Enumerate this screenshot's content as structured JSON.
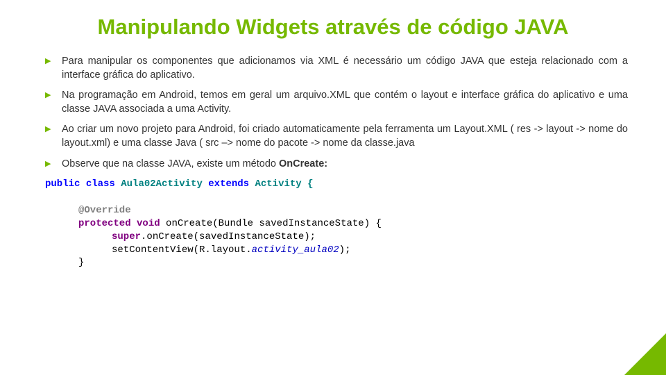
{
  "title": "Manipulando Widgets através de código JAVA",
  "bullets": [
    "Para manipular os componentes que adicionamos via XML é necessário um código JAVA que esteja relacionado com a interface gráfica do aplicativo.",
    "Na programação em Android, temos em geral um arquivo.XML que contém o layout e interface gráfica do aplicativo e uma classe JAVA associada a uma Activity.",
    "Ao criar um novo projeto para Android, foi criado automaticamente pela ferramenta um Layout.XML ( res -> layout -> nome do layout.xml) e uma classe Java ( src –> nome do pacote -> nome da classe.java",
    "Observe que na classe JAVA, existe um método "
  ],
  "bullet4_bold": "OnCreate:",
  "code": {
    "l1_a": "public",
    "l1_b": "class",
    "l1_c": " Aula02Activity ",
    "l1_d": "extends",
    "l1_e": " Activity {",
    "l2": "@Override",
    "l3_a": "protected",
    "l3_b": "void",
    "l3_c": " onCreate(Bundle savedInstanceState) {",
    "l4_a": "super",
    "l4_b": ".onCreate(savedInstanceState);",
    "l5_a": "setContentView(R.layout.",
    "l5_b": "activity_aula02",
    "l5_c": ");",
    "l6": "}"
  }
}
